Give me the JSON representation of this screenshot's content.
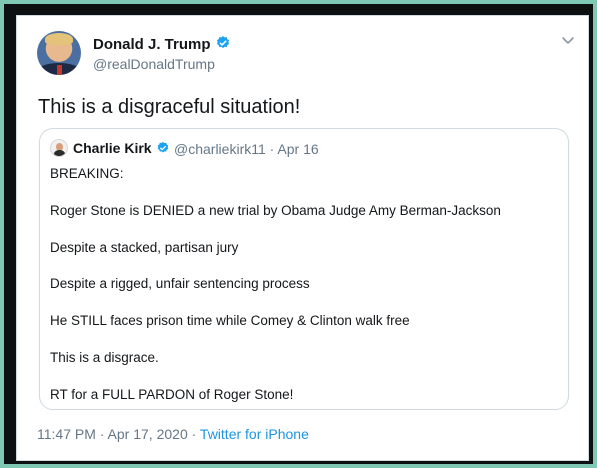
{
  "tweet": {
    "author_name": "Donald J. Trump",
    "author_handle": "@realDonaldTrump",
    "text": "This is a disgraceful situation!",
    "timestamp": "11:47 PM · Apr 17, 2020 · ",
    "source": "Twitter for iPhone"
  },
  "quote": {
    "author_name": "Charlie Kirk",
    "meta": "@charliekirk11 · Apr 16",
    "lines": [
      "BREAKING:",
      "Roger Stone is DENIED a new trial by Obama Judge Amy Berman-Jackson",
      "Despite a stacked, partisan jury",
      "Despite a rigged, unfair sentencing process",
      "He STILL faces prison time while Comey & Clinton walk free",
      "This is a disgrace.",
      "RT for a FULL PARDON of Roger Stone!"
    ]
  },
  "icons": {
    "verified": "verified-badge-icon",
    "menu": "chevron-down-icon"
  },
  "colors": {
    "frame": "#7fc9b4",
    "border": "#0c1010",
    "verified": "#1da1f2",
    "link": "#1b95e0",
    "muted": "#657786"
  }
}
